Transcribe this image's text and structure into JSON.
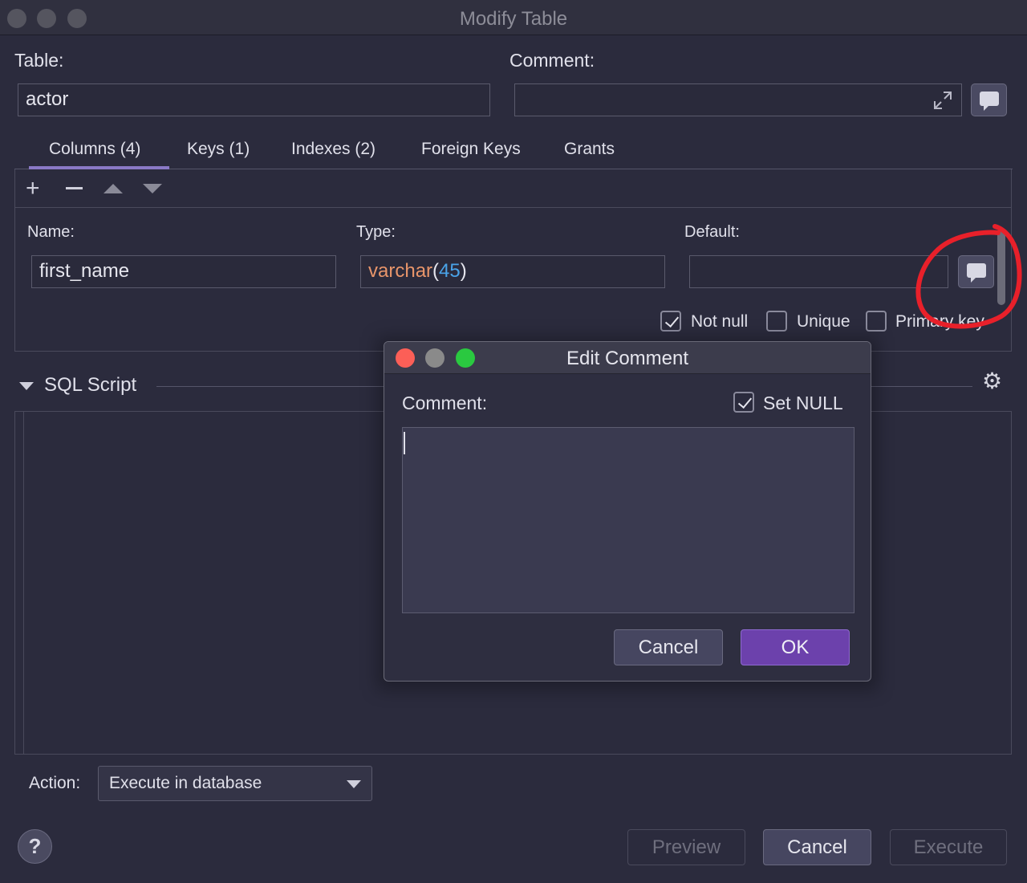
{
  "window": {
    "title": "Modify Table"
  },
  "table": {
    "label": "Table:",
    "value": "actor"
  },
  "comment": {
    "label": "Comment:",
    "value": ""
  },
  "tabs": [
    {
      "label": "Columns (4)"
    },
    {
      "label": "Keys (1)"
    },
    {
      "label": "Indexes (2)"
    },
    {
      "label": "Foreign Keys"
    },
    {
      "label": "Grants"
    }
  ],
  "column": {
    "name_label": "Name:",
    "name_value": "first_name",
    "type_label": "Type:",
    "type_base": "varchar",
    "type_open": "(",
    "type_size": "45",
    "type_close": ")",
    "default_label": "Default:",
    "default_value": ""
  },
  "checks": {
    "not_null": {
      "label": "Not null",
      "checked": true
    },
    "unique": {
      "label": "Unique",
      "checked": false
    },
    "primary_key": {
      "label": "Primary key",
      "checked": false
    }
  },
  "sql": {
    "label": "SQL Script"
  },
  "action": {
    "label": "Action:",
    "value": "Execute in database"
  },
  "buttons": {
    "help": "?",
    "preview": "Preview",
    "cancel": "Cancel",
    "execute": "Execute"
  },
  "dialog": {
    "title": "Edit Comment",
    "comment_label": "Comment:",
    "set_null_label": "Set NULL",
    "set_null_checked": true,
    "cancel": "Cancel",
    "ok": "OK"
  },
  "colors": {
    "accent": "#6c41ac",
    "type_keyword": "#e8956a",
    "type_number": "#4aa3e8",
    "annotation": "#e8202a",
    "traffic_red": "#fc5f57",
    "traffic_yellow_inactive": "#8a8a8a",
    "traffic_green": "#2ac940"
  }
}
